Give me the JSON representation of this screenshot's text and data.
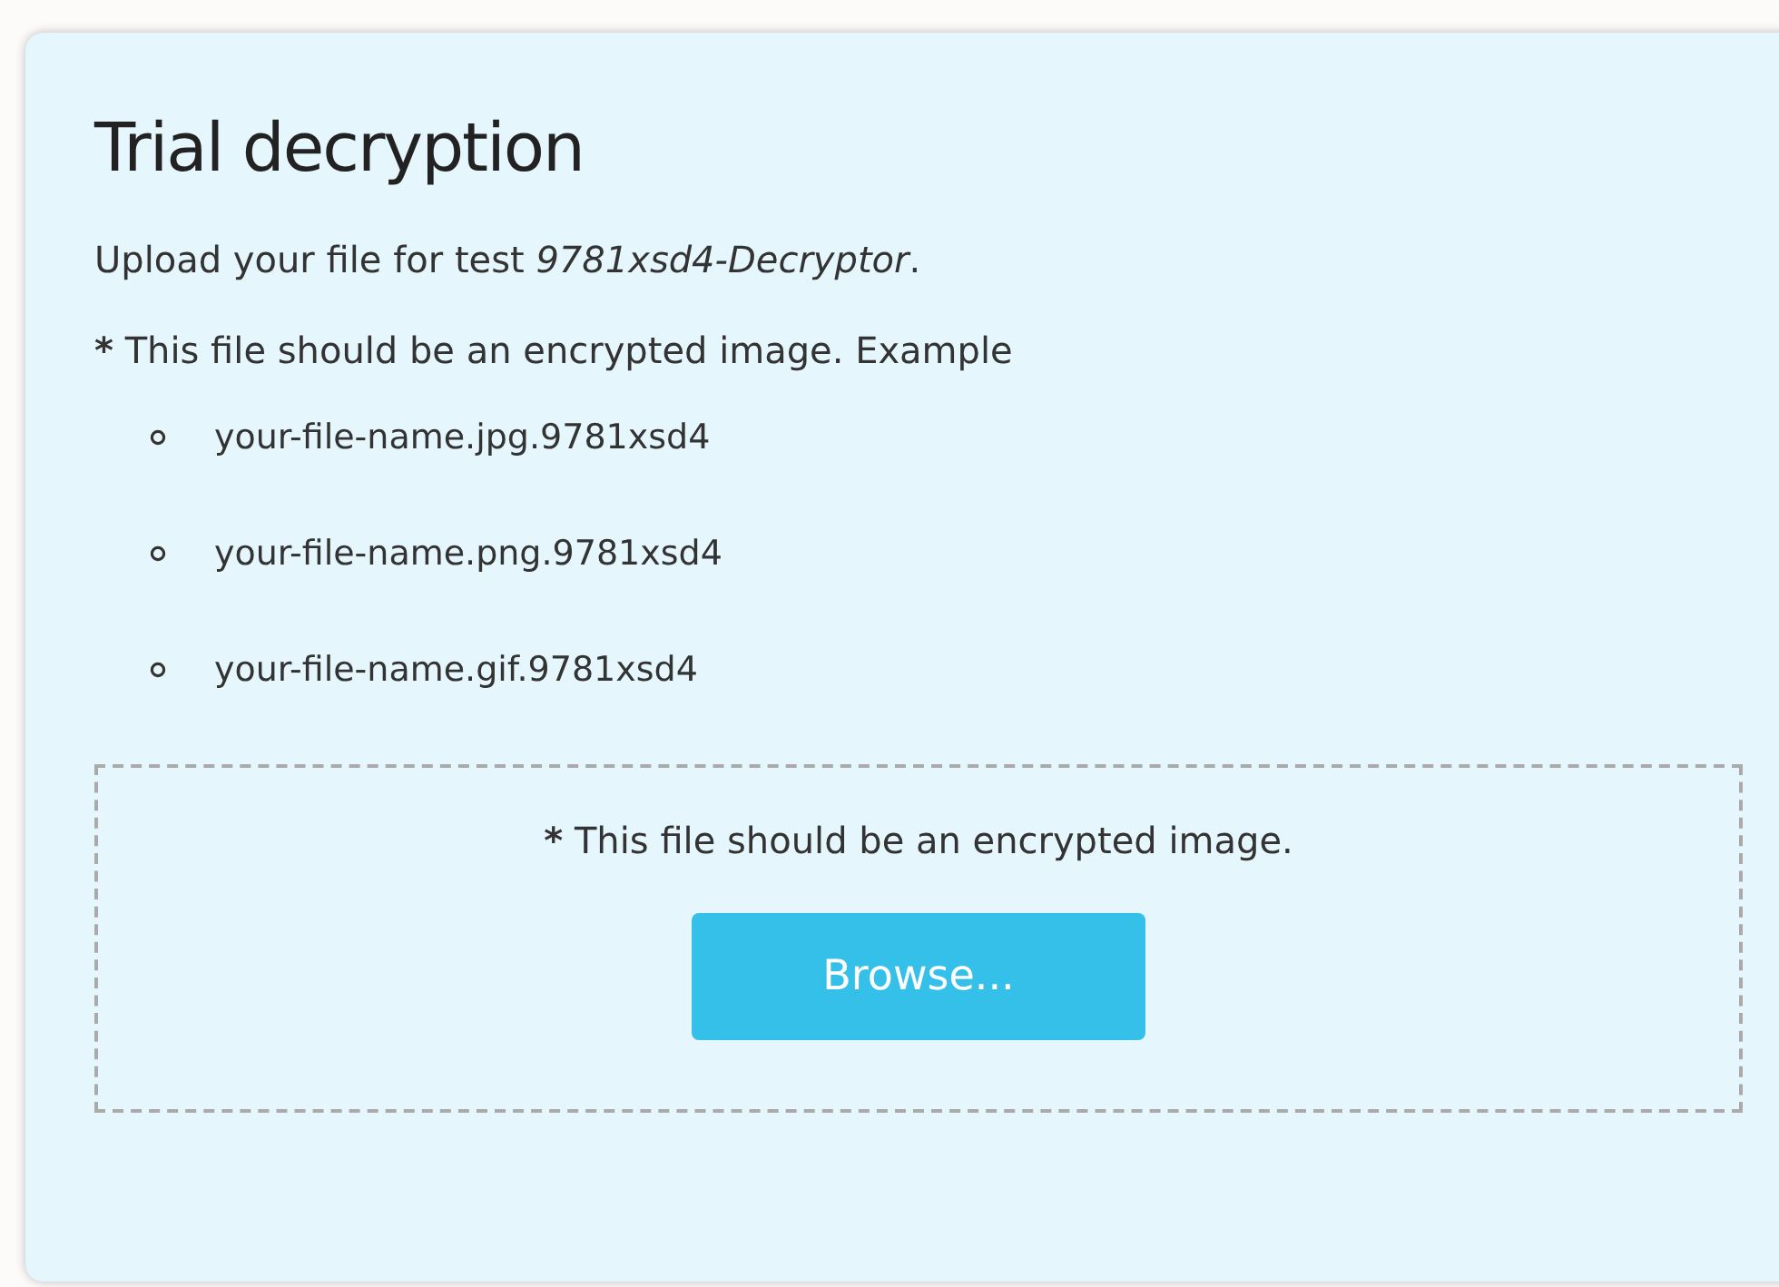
{
  "panel": {
    "title": "Trial decryption",
    "intro": "Upload your file for test *9781xsd4-Decryptor*.",
    "note": {
      "marker": "*",
      "text": "This file should be an encrypted image. Example"
    },
    "examples": [
      "your-file-name.jpg.9781xsd4",
      "your-file-name.png.9781xsd4",
      "your-file-name.gif.9781xsd4"
    ],
    "dropzone": {
      "note": {
        "marker": "*",
        "text": "This file should be an encrypted image."
      },
      "button": "Browse..."
    }
  }
}
